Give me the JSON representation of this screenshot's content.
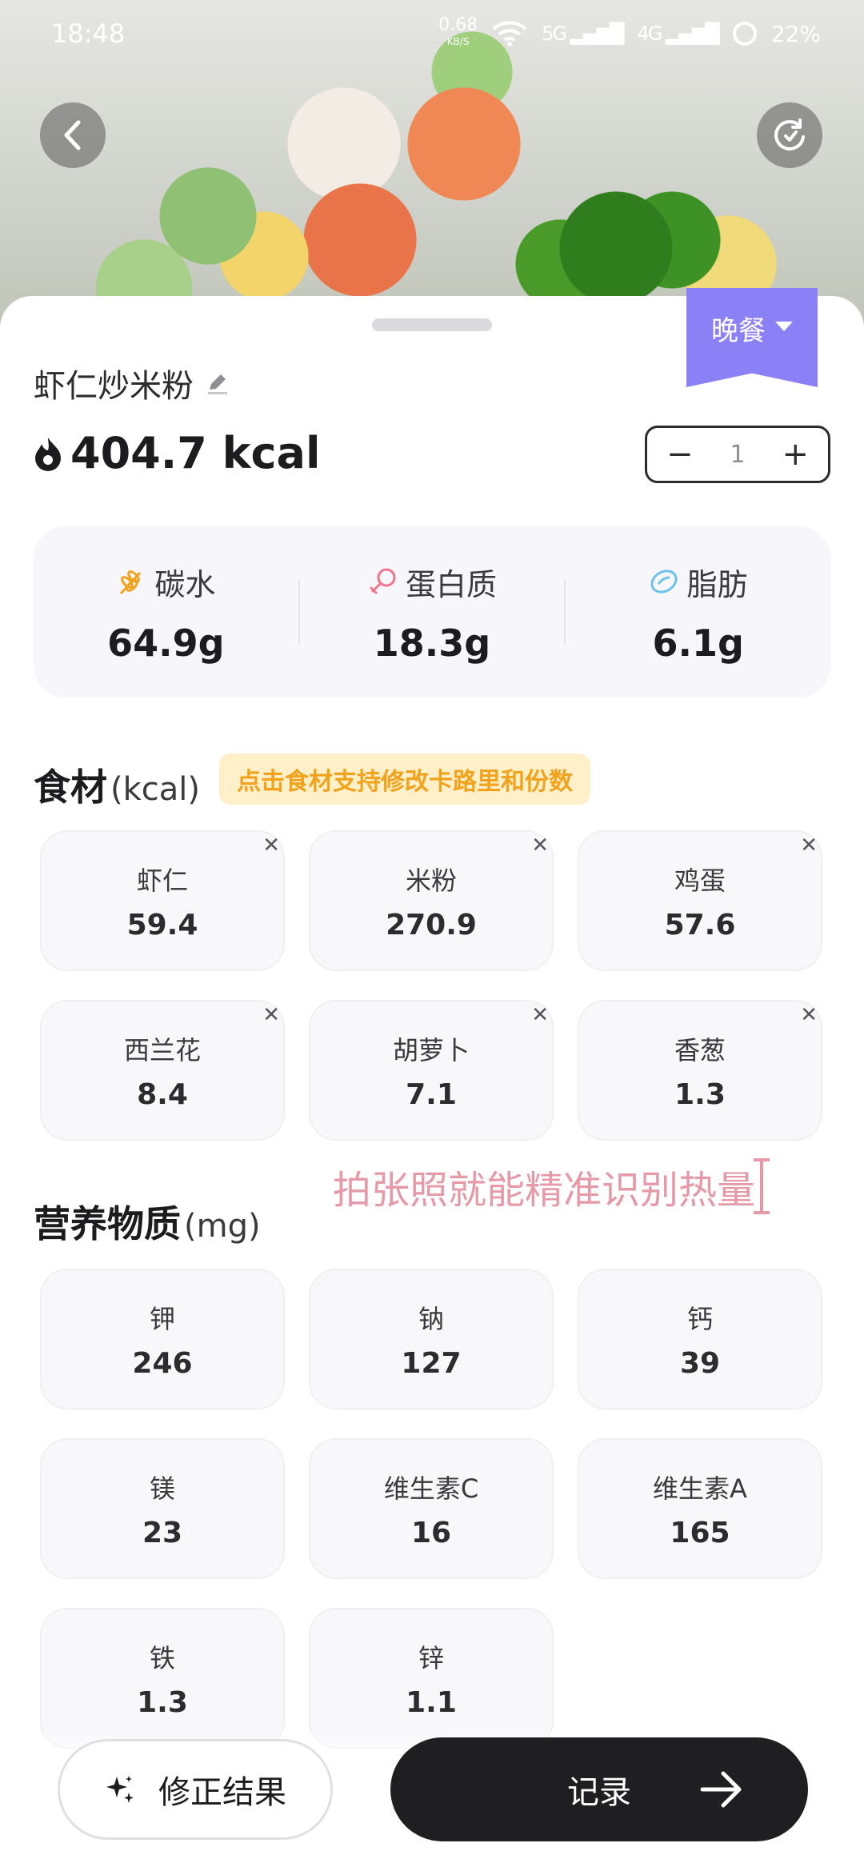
{
  "status_bar": {
    "time": "18:48",
    "net_speed": "0.68",
    "net_unit": "KB/S",
    "sig1": "5G",
    "sig2": "4G",
    "battery": "22%"
  },
  "meal": {
    "label": "晚餐"
  },
  "dish": {
    "name": "虾仁炒米粉",
    "calories": "404.7 kcal",
    "servings": "1"
  },
  "macros": [
    {
      "label": "碳水",
      "value": "64.9g",
      "icon": "wheat-icon",
      "color": "#f2a21b"
    },
    {
      "label": "蛋白质",
      "value": "18.3g",
      "icon": "drumstick-icon",
      "color": "#f0748a"
    },
    {
      "label": "脂肪",
      "value": "6.1g",
      "icon": "oil-drop-icon",
      "color": "#6cc3e8"
    }
  ],
  "ingredients": {
    "title": "食材",
    "unit": "(kcal)",
    "tip": "点击食材支持修改卡路里和份数",
    "items": [
      {
        "name": "虾仁",
        "value": "59.4"
      },
      {
        "name": "米粉",
        "value": "270.9"
      },
      {
        "name": "鸡蛋",
        "value": "57.6"
      },
      {
        "name": "西兰花",
        "value": "8.4"
      },
      {
        "name": "胡萝卜",
        "value": "7.1"
      },
      {
        "name": "香葱",
        "value": "1.3"
      }
    ]
  },
  "overlay_caption": "拍张照就能精准识别热量",
  "nutrients": {
    "title": "营养物质",
    "unit": "(mg)",
    "items": [
      {
        "name": "钾",
        "value": "246"
      },
      {
        "name": "钠",
        "value": "127"
      },
      {
        "name": "钙",
        "value": "39"
      },
      {
        "name": "镁",
        "value": "23"
      },
      {
        "name": "维生素C",
        "value": "16"
      },
      {
        "name": "维生素A",
        "value": "165"
      },
      {
        "name": "铁",
        "value": "1.3"
      },
      {
        "name": "锌",
        "value": "1.1"
      }
    ]
  },
  "actions": {
    "correct": "修正结果",
    "record": "记录"
  },
  "colors": {
    "accent": "#8b80f5",
    "tip_bg": "#fff0c9",
    "tip_text": "#f2a21b",
    "caption": "#e69aa8"
  }
}
